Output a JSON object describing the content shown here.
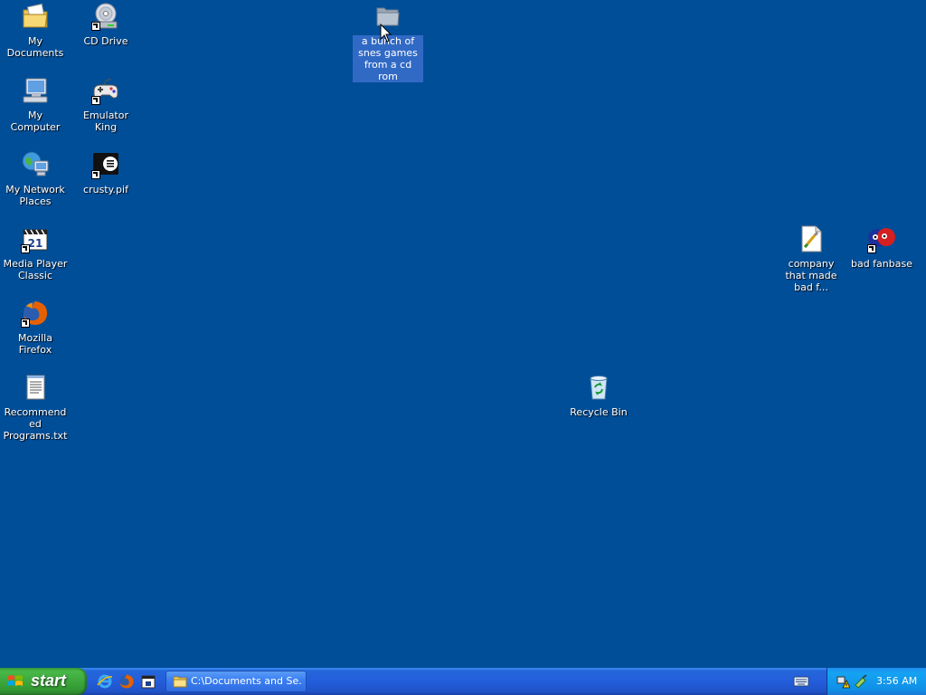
{
  "desktop": {
    "icons": [
      {
        "label": "My Documents",
        "icon": "my-documents-icon"
      },
      {
        "label": "CD Drive",
        "icon": "cd-drive-icon"
      },
      {
        "label": "a bunch of snes games from a cd rom",
        "icon": "folder-icon",
        "selected": true
      },
      {
        "label": "My Computer",
        "icon": "my-computer-icon"
      },
      {
        "label": "Emulator King",
        "icon": "gamepad-icon"
      },
      {
        "label": "My Network Places",
        "icon": "network-places-icon"
      },
      {
        "label": "crusty.pif",
        "icon": "pif-program-icon"
      },
      {
        "label": "Media Player Classic",
        "icon": "media-player-classic-icon"
      },
      {
        "label": "company that made bad f...",
        "icon": "paint-document-icon"
      },
      {
        "label": "bad fanbase",
        "icon": "bad-fanbase-icon"
      },
      {
        "label": "Mozilla Firefox",
        "icon": "firefox-icon"
      },
      {
        "label": "Recommended Programs.txt",
        "icon": "text-file-icon"
      },
      {
        "label": "Recycle Bin",
        "icon": "recycle-bin-icon"
      }
    ]
  },
  "taskbar": {
    "start_label": "start",
    "quick_launch": [
      "internet-explorer-icon",
      "firefox-icon",
      "media-player-classic-icon"
    ],
    "tasks": [
      {
        "label": "C:\\Documents and Se...",
        "icon": "folder-icon",
        "active": false
      }
    ],
    "tray": {
      "icons": [
        "network-warning-icon",
        "safely-remove-icon"
      ],
      "clock": "3:56 AM"
    },
    "language_bar_icon": "keyboard-icon"
  },
  "colors": {
    "desktop_background": "#004e98",
    "taskbar_blue": "#245edb",
    "start_green": "#3c9e3c",
    "selection": "#316ac5"
  }
}
